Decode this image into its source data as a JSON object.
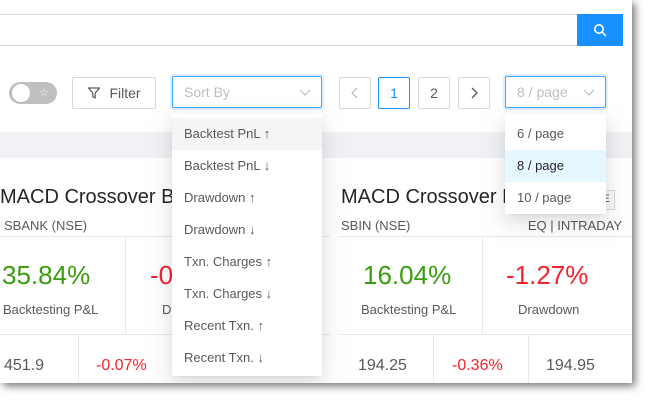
{
  "search": {
    "placeholder": "",
    "button_icon": "search-icon"
  },
  "toolbar": {
    "toggle_icon": "star-icon",
    "filter_label": "Filter",
    "sort_placeholder": "Sort By",
    "pagination": {
      "prev": "<",
      "pages": [
        "1",
        "2"
      ],
      "current": "1",
      "next": ">"
    },
    "page_size_value": "8 / page"
  },
  "sort_options": [
    "Backtest PnL ↑",
    "Backtest PnL ↓",
    "Drawdown ↑",
    "Drawdown ↓",
    "Txn. Charges ↑",
    "Txn. Charges ↓",
    "Recent Txn. ↑",
    "Recent Txn. ↓"
  ],
  "page_size_options": [
    "6 / page",
    "8 / page",
    "10 / page"
  ],
  "cards": [
    {
      "title": "MACD Crossover BO",
      "symbol": "SBANK (NSE)",
      "pnl": "35.84%",
      "pnl_label": "Backtesting P&L",
      "drawdown": "-0",
      "drawdown_label": "D",
      "bottom": [
        "451.9",
        "-0.07%"
      ]
    },
    {
      "title": "MACD Crossover B",
      "tag": "VE",
      "symbol": "SBIN (NSE)",
      "meta": "EQ | INTRADAY",
      "pnl": "16.04%",
      "pnl_label": "Backtesting P&L",
      "drawdown": "-1.27%",
      "drawdown_label": "Drawdown",
      "bottom": [
        "194.25",
        "-0.36%",
        "194.95"
      ]
    }
  ],
  "colors": {
    "accent": "#1890ff",
    "positive": "#389e0d",
    "negative": "#f5222d"
  }
}
